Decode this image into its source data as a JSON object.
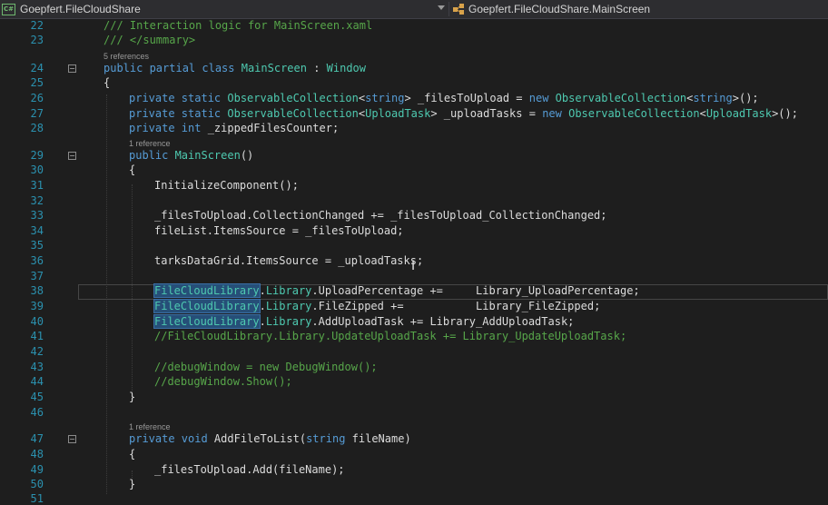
{
  "navigation": {
    "project": "Goepfert.FileCloudShare",
    "project_icon_text": "C#",
    "type": "Goepfert.FileCloudShare.MainScreen"
  },
  "lines": {
    "l22": {
      "num": "22",
      "c": "/// Interaction logic for MainScreen.xaml"
    },
    "l23": {
      "num": "23",
      "c": "/// </summary>"
    },
    "r23": "5 references",
    "l24": {
      "num": "24",
      "a": "public partial class ",
      "b": "MainScreen",
      "c": " : ",
      "d": "Window"
    },
    "l25": {
      "num": "25",
      "a": "{"
    },
    "l26": {
      "num": "26",
      "a": "private static ",
      "b": "ObservableCollection",
      "c": "<",
      "d": "string",
      "e": "> _filesToUpload = ",
      "f": "new ",
      "g": "ObservableCollection",
      "h": "<",
      "i": "string",
      "j": ">();"
    },
    "l27": {
      "num": "27",
      "a": "private static ",
      "b": "ObservableCollection",
      "c": "<",
      "d": "UploadTask",
      "e": "> _uploadTasks = ",
      "f": "new ",
      "g": "ObservableCollection",
      "h": "<",
      "i": "UploadTask",
      "j": ">();"
    },
    "l28": {
      "num": "28",
      "a": "private int ",
      "b": "_zippedFilesCounter;"
    },
    "r28": "1 reference",
    "l29": {
      "num": "29",
      "a": "public ",
      "b": "MainScreen",
      "c": "()"
    },
    "l30": {
      "num": "30",
      "a": "{"
    },
    "l31": {
      "num": "31",
      "a": "InitializeComponent();"
    },
    "l32": {
      "num": "32"
    },
    "l33": {
      "num": "33",
      "a": "_filesToUpload.CollectionChanged += _filesToUpload_CollectionChanged;"
    },
    "l34": {
      "num": "34",
      "a": "fileList.ItemsSource = _filesToUpload;"
    },
    "l35": {
      "num": "35"
    },
    "l36": {
      "num": "36",
      "a": "tarksDataGrid.ItemsSource = _uploadTasks;"
    },
    "l37": {
      "num": "37"
    },
    "l38": {
      "num": "38",
      "a": "FileCloudLibrary",
      "b": ".",
      "c": "Library",
      "d": ".UploadPercentage +=     Library_UploadPercentage;"
    },
    "l39": {
      "num": "39",
      "a": "FileCloudLibrary",
      "b": ".",
      "c": "Library",
      "d": ".FileZipped +=           Library_FileZipped;"
    },
    "l40": {
      "num": "40",
      "a": "FileCloudLibrary",
      "b": ".",
      "c": "Library",
      "d": ".AddUploadTask += Library_AddUploadTask;"
    },
    "l41": {
      "num": "41",
      "c": "//FileCloudLibrary.Library.UpdateUploadTask += Library_UpdateUploadTask;"
    },
    "l42": {
      "num": "42"
    },
    "l43": {
      "num": "43",
      "c": "//debugWindow = new DebugWindow();"
    },
    "l44": {
      "num": "44",
      "c": "//debugWindow.Show();"
    },
    "l45": {
      "num": "45",
      "a": "}"
    },
    "l46": {
      "num": "46"
    },
    "r46": "1 reference",
    "l47": {
      "num": "47",
      "a": "private void ",
      "b": "AddFileToList(",
      "c": "string ",
      "d": "fileName)"
    },
    "l48": {
      "num": "48",
      "a": "{"
    },
    "l49": {
      "num": "49",
      "a": "_filesToUpload.Add(fileName);"
    },
    "l50": {
      "num": "50",
      "a": "}"
    },
    "l51": {
      "num": "51"
    }
  },
  "colors": {
    "background": "#1e1e1e",
    "line_number": "#2b91af",
    "keyword": "#569cd6",
    "type": "#4ec9b0",
    "comment": "#57a64a",
    "text": "#dcdcdc",
    "selection": "#264f78"
  },
  "icons": {
    "project": "csharp-project-icon",
    "class": "class-icon",
    "fold_collapse": "fold-collapse-icon",
    "text_cursor": "ibeam-cursor-icon"
  }
}
